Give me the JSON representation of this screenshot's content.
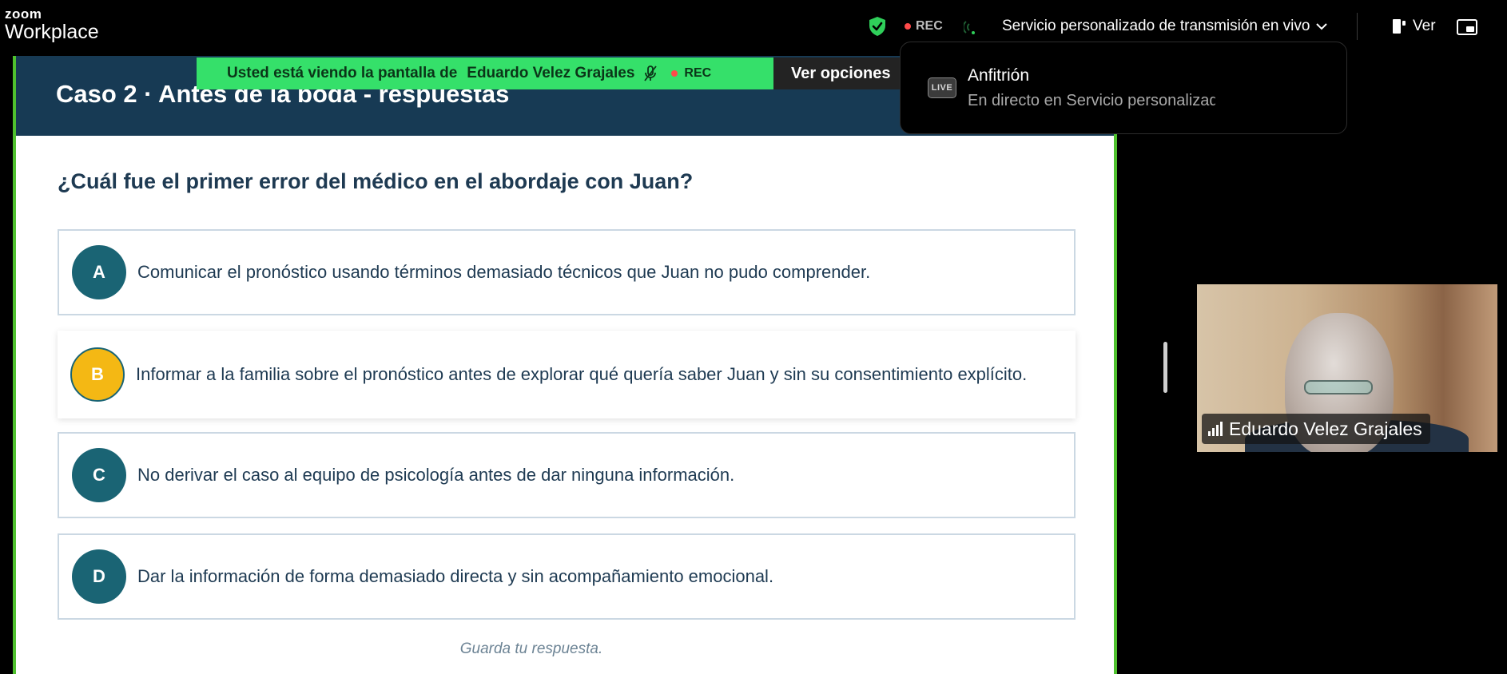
{
  "app": {
    "logo_top": "zoom",
    "logo_bottom": "Workplace",
    "rec_label": "REC",
    "stream_label": "Servicio personalizado de transmisión en vivo",
    "view_label": "Ver"
  },
  "share_banner": {
    "prefix": "Usted está viendo la pantalla de",
    "presenter": "Eduardo Velez Grajales",
    "rec_label": "REC",
    "view_options_label": "Ver opciones"
  },
  "popup": {
    "badge": "LIVE",
    "title": "Anfitrión",
    "subtitle": "En directo en Servicio personalizado de transmisión en vivo"
  },
  "slide": {
    "title": "Caso 2 · Antes de la boda  - respuestas",
    "question": "¿Cuál fue el primer error del médico en el abordaje con Juan?",
    "options": [
      {
        "letter": "A",
        "text": "Comunicar el pronóstico usando términos demasiado técnicos que Juan no pudo comprender."
      },
      {
        "letter": "B",
        "text": "Informar a la familia sobre el pronóstico antes de explorar qué quería saber Juan y sin su consentimiento explícito."
      },
      {
        "letter": "C",
        "text": "No derivar el caso al equipo de psicología antes de dar ninguna información."
      },
      {
        "letter": "D",
        "text": "Dar la información de forma demasiado directa y sin acompañamiento emocional."
      }
    ],
    "selected_option": "B",
    "save_note": "Guarda tu respuesta."
  },
  "participant": {
    "name": "Eduardo Velez Grajales"
  },
  "colors": {
    "banner_green": "#35e06a",
    "share_border": "#4fc12e",
    "header_navy": "#173a54",
    "option_teal": "#1a6474",
    "selected_yellow": "#f4b814"
  }
}
